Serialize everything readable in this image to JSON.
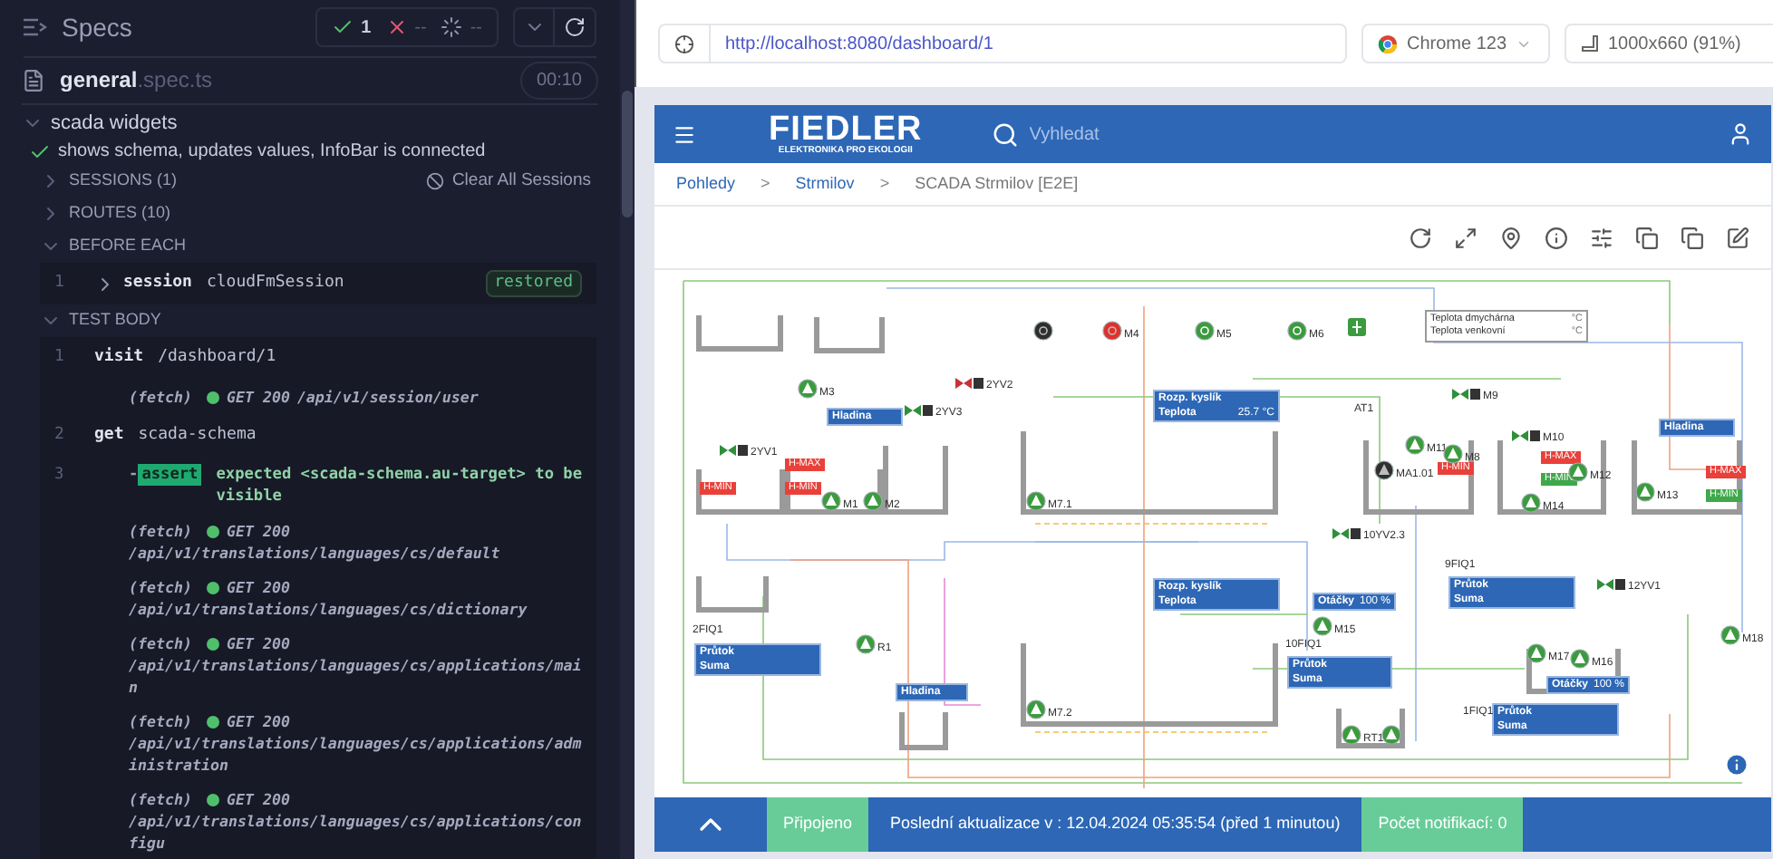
{
  "runner": {
    "title": "Specs",
    "passed": "1",
    "failed": "--",
    "pending": "--",
    "spec": {
      "name": "general",
      "ext": ".spec.ts",
      "duration": "00:10"
    },
    "suite": {
      "title": "scada widgets",
      "expanded": true
    },
    "test": {
      "title": "shows schema, updates values, InfoBar is connected",
      "passed": true
    },
    "sections": [
      {
        "label": "SESSIONS (1)",
        "expanded": false,
        "action": "Clear All Sessions"
      },
      {
        "label": "ROUTES (10)",
        "expanded": false
      },
      {
        "label": "BEFORE EACH",
        "expanded": true,
        "commands": [
          {
            "kind": "command",
            "number": "1",
            "name": "session",
            "message": "cloudFmSession",
            "badge": "restored",
            "expandable": true
          }
        ]
      },
      {
        "label": "TEST BODY",
        "expanded": true,
        "commands": [
          {
            "kind": "command",
            "number": "1",
            "name": "visit",
            "message": "/dashboard/1",
            "expandable": false
          },
          {
            "kind": "fetch",
            "name": "(fetch)",
            "method": "GET 200",
            "url": "/api/v1/session/user"
          },
          {
            "kind": "command",
            "number": "2",
            "name": "get",
            "message": "scada-schema",
            "expandable": false
          },
          {
            "kind": "assert",
            "number": "3",
            "prefix": "-",
            "name": "assert",
            "message": "expected <scada-schema.au-target> to be visible"
          },
          {
            "kind": "fetch",
            "name": "(fetch)",
            "method": "GET 200",
            "url": "/api/v1/translations/languages/cs/default"
          },
          {
            "kind": "fetch",
            "name": "(fetch)",
            "method": "GET 200",
            "url": "/api/v1/translations/languages/cs/dictionary"
          },
          {
            "kind": "fetch",
            "name": "(fetch)",
            "method": "GET 200",
            "url": "/api/v1/translations/languages/cs/applications/main"
          },
          {
            "kind": "fetch",
            "name": "(fetch)",
            "method": "GET 200",
            "url": "/api/v1/translations/languages/cs/applications/administration"
          },
          {
            "kind": "fetch",
            "name": "(fetch)",
            "method": "GET 200",
            "url": "/api/v1/translations/languages/cs/applications/configu"
          }
        ]
      }
    ]
  },
  "browser": {
    "url": "http://localhost:8080/dashboard/1",
    "browser": "Chrome 123",
    "viewport": "1000x660 (91%)"
  },
  "app": {
    "logo": "FIEDLER",
    "logo_tagline": "ELEKTRONIKA PRO EKOLOGII",
    "search": {
      "placeholder": "Vyhledat"
    },
    "breadcrumbs": [
      {
        "kind": "link",
        "label": "Pohledy"
      },
      {
        "kind": "separator",
        "label": ">"
      },
      {
        "kind": "link",
        "label": "Strmilov"
      },
      {
        "kind": "separator",
        "label": ">"
      },
      {
        "kind": "current",
        "label": "SCADA Strmilov [E2E]"
      }
    ],
    "scada": {
      "panels": [
        {
          "rows": [
            {
              "label": "Hladina"
            }
          ]
        },
        {
          "rows": [
            {
              "label": "Rozp. kyslík"
            },
            {
              "label": "Teplota",
              "value": "25.7 °C"
            }
          ]
        },
        {
          "rows": [
            {
              "label": "Rozp. kyslík"
            },
            {
              "label": "Teplota"
            }
          ]
        },
        {
          "rows": [
            {
              "label": "Průtok"
            },
            {
              "label": "Suma"
            }
          ]
        },
        {
          "rows": [
            {
              "label": "Hladina"
            }
          ]
        },
        {
          "rows": [
            {
              "label": "Otáčky",
              "value": "100 %"
            }
          ]
        },
        {
          "rows": [
            {
              "label": "Průtok"
            },
            {
              "label": "Suma"
            }
          ]
        },
        {
          "rows": [
            {
              "label": "Průtok"
            },
            {
              "label": "Suma"
            }
          ]
        },
        {
          "rows": [
            {
              "label": "Otáčky",
              "value": "100 %"
            }
          ]
        },
        {
          "rows": [
            {
              "label": "Průtok"
            },
            {
              "label": "Suma"
            }
          ]
        },
        {
          "rows": [
            {
              "label": "Hladina"
            }
          ]
        }
      ],
      "legend": [
        {
          "label": "Teplota dmychárna",
          "unit": "°C"
        },
        {
          "label": "Teplota venkovní",
          "unit": "°C"
        }
      ],
      "alarms": [
        {
          "label": "H-MAX",
          "active": true
        },
        {
          "label": "H-MIN",
          "active": true
        },
        {
          "label": "H-MIN",
          "active": true
        },
        {
          "label": "H-MIN",
          "active": true
        },
        {
          "label": "H-MAX",
          "active": true
        },
        {
          "label": "H-MIN",
          "active": false
        },
        {
          "label": "H-MAX",
          "active": true
        },
        {
          "label": "H-MIN",
          "active": false
        }
      ],
      "equipment": [
        {
          "kind": "motor",
          "running": false,
          "fault": false
        },
        {
          "kind": "motor",
          "label": "M4",
          "running": false,
          "fault": true
        },
        {
          "kind": "motor",
          "label": "M5",
          "running": true,
          "fault": false
        },
        {
          "kind": "motor",
          "label": "M6",
          "running": true,
          "fault": false
        },
        {
          "kind": "blower",
          "running": true,
          "fault": false
        },
        {
          "kind": "pump",
          "label": "M3",
          "running": true,
          "fault": false
        },
        {
          "kind": "pump",
          "label": "M1",
          "running": true,
          "fault": false
        },
        {
          "kind": "pump",
          "label": "M2",
          "running": true,
          "fault": false
        },
        {
          "kind": "pump",
          "label": "M7.1",
          "running": true,
          "fault": false
        },
        {
          "kind": "pump",
          "label": "M7.2",
          "running": true,
          "fault": false
        },
        {
          "kind": "pump",
          "label": "R1",
          "running": true,
          "fault": false
        },
        {
          "kind": "pump",
          "label": "M11",
          "running": true,
          "fault": false
        },
        {
          "kind": "pump",
          "label": "MA1.01",
          "running": false,
          "fault": false
        },
        {
          "kind": "pump",
          "label": "M8",
          "running": true,
          "fault": false
        },
        {
          "kind": "pump",
          "label": "M12",
          "running": true,
          "fault": false
        },
        {
          "kind": "pump",
          "label": "M14",
          "running": true,
          "fault": false
        },
        {
          "kind": "pump",
          "label": "M13",
          "running": true,
          "fault": false
        },
        {
          "kind": "pump",
          "label": "M15",
          "running": true,
          "fault": false
        },
        {
          "kind": "pump",
          "label": "M17",
          "running": true,
          "fault": false
        },
        {
          "kind": "pump",
          "label": "M16",
          "running": true,
          "fault": false
        },
        {
          "kind": "pump",
          "label": "M18",
          "running": true,
          "fault": false
        },
        {
          "kind": "pump",
          "label": "RT1",
          "running": true,
          "fault": false
        },
        {
          "kind": "pump",
          "running": true,
          "fault": false
        },
        {
          "kind": "valve",
          "label": "2YV1",
          "open": true
        },
        {
          "kind": "valve",
          "label": "2YV2",
          "open": false
        },
        {
          "kind": "valve",
          "label": "2YV3",
          "open": true
        },
        {
          "kind": "valve",
          "label": "10YV2.3",
          "open": true
        },
        {
          "kind": "valve",
          "label": "12YV1",
          "open": true
        },
        {
          "kind": "valve",
          "label": "M9",
          "open": true
        },
        {
          "kind": "valve",
          "label": "M10",
          "open": true
        }
      ],
      "tags": [
        {
          "label": "2FIQ1"
        },
        {
          "label": "10FIQ1"
        },
        {
          "label": "9FIQ1"
        },
        {
          "label": "1FIQ1"
        },
        {
          "label": "AT1"
        }
      ]
    },
    "status_bar": {
      "connection": "Připojeno",
      "connected": true,
      "last_update": "Poslední aktualizace v : 12.04.2024 05:35:54 (před 1 minutou)",
      "notifications": "Počet notifikací: 0"
    }
  }
}
